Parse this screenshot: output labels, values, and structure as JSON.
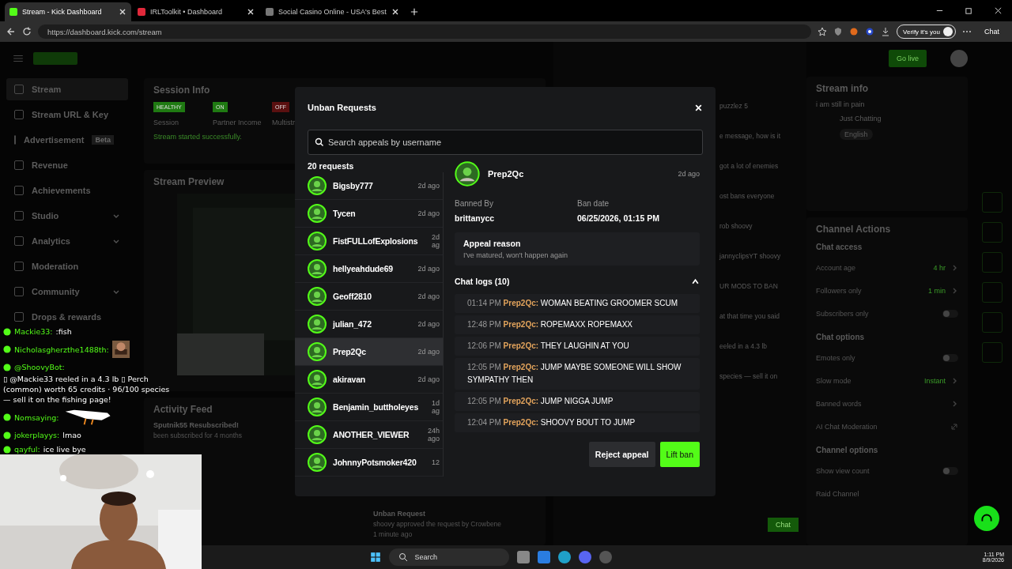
{
  "browser": {
    "tabs": [
      {
        "title": "Stream - Kick Dashboard",
        "selected": true
      },
      {
        "title": "IRLToolkit • Dashboard",
        "selected": false
      },
      {
        "title": "Social Casino Online - USA's Best",
        "selected": false
      }
    ],
    "url": "https://dashboard.kick.com/stream",
    "verify": "Verify it's you",
    "chat": "Chat"
  },
  "dashboard": {
    "sidebar": [
      {
        "label": "Stream",
        "selected": true,
        "expandable": false
      },
      {
        "label": "Stream URL & Key",
        "selected": false,
        "expandable": false
      },
      {
        "label": "Advertisement",
        "badge": "Beta",
        "selected": false,
        "expandable": false
      },
      {
        "label": "Revenue",
        "selected": false,
        "expandable": false
      },
      {
        "label": "Achievements",
        "selected": false,
        "expandable": false
      },
      {
        "label": "Studio",
        "selected": false,
        "expandable": true
      },
      {
        "label": "Analytics",
        "selected": false,
        "expandable": true
      },
      {
        "label": "Moderation",
        "selected": false,
        "expandable": false
      },
      {
        "label": "Community",
        "selected": false,
        "expandable": true
      },
      {
        "label": "Drops & rewards",
        "selected": false,
        "expandable": false
      }
    ],
    "session_info": {
      "title": "Session Info",
      "statuses": [
        {
          "badge": "HEALTHY",
          "label": "Session",
          "color": "#1f7a12"
        },
        {
          "badge": "ON",
          "label": "Partner Income",
          "color": "#1f7a12"
        },
        {
          "badge": "OFF",
          "label": "Multistr",
          "color": "#5a1010"
        }
      ],
      "message": "Stream started successfully."
    },
    "stream_preview": {
      "title": "Stream Preview"
    },
    "activity_feed": {
      "title": "Activity Feed",
      "items": [
        {
          "title": "Sputnik55 Resubscribed!",
          "detail": "been subscribed for 4 months"
        },
        {
          "title": "Unban Request",
          "detail": "shoovy approved the request by Crowbene",
          "time": "1 minute ago"
        }
      ]
    },
    "mid_chat": {
      "lines": [
        "puzzlez 5",
        "e message, how is it",
        "got a lot of enemies",
        "ost bans everyone",
        "rob shoovy",
        "jannyclipsYT shoovy",
        "UR MODS TO BAN",
        "at that time you said",
        "eeled in a 4.3 lb",
        "species — sell it on"
      ],
      "send": "Chat"
    },
    "go_live": "Go live",
    "stream_info": {
      "title": "Stream info",
      "stream_title": "i am still in pain",
      "category": "Just Chatting",
      "language": "English"
    },
    "channel_actions": {
      "title": "Channel Actions",
      "sections": [
        {
          "heading": "Chat access",
          "rows": [
            {
              "label": "Account age",
              "kind": "value",
              "value": "4 hr"
            },
            {
              "label": "Followers only",
              "kind": "value",
              "value": "1 min"
            },
            {
              "label": "Subscribers only",
              "kind": "toggle",
              "on": false
            }
          ]
        },
        {
          "heading": "Chat options",
          "rows": [
            {
              "label": "Emotes only",
              "kind": "toggle",
              "on": false
            },
            {
              "label": "Slow mode",
              "kind": "value",
              "value": "Instant"
            },
            {
              "label": "Banned words",
              "kind": "link"
            },
            {
              "label": "AI Chat Moderation",
              "kind": "external"
            }
          ]
        },
        {
          "heading": "Channel options",
          "rows": [
            {
              "label": "Show view count",
              "kind": "toggle",
              "on": false
            },
            {
              "label": "Raid Channel",
              "kind": "plain"
            }
          ]
        }
      ]
    }
  },
  "modal": {
    "title": "Unban Requests",
    "search_placeholder": "Search appeals by username",
    "count": "20 requests",
    "requests": [
      {
        "name": "Bigsby777",
        "time": "2d ago",
        "selected": false
      },
      {
        "name": "Tycen",
        "time": "2d ago",
        "selected": false
      },
      {
        "name": "FistFULLofExplosions",
        "time": "2d ag",
        "selected": false
      },
      {
        "name": "hellyeahdude69",
        "time": "2d ago",
        "selected": false
      },
      {
        "name": "Geoff2810",
        "time": "2d ago",
        "selected": false
      },
      {
        "name": "julian_472",
        "time": "2d ago",
        "selected": false
      },
      {
        "name": "Prep2Qc",
        "time": "2d ago",
        "selected": true
      },
      {
        "name": "akiravan",
        "time": "2d ago",
        "selected": false
      },
      {
        "name": "Benjamin_buttholeyes",
        "time": "1d ag",
        "selected": false
      },
      {
        "name": "ANOTHER_VIEWER",
        "time": "24h ago",
        "selected": false
      },
      {
        "name": "JohnnyPotsmoker420",
        "time": "12",
        "selected": false
      }
    ],
    "detail": {
      "name": "Prep2Qc",
      "time": "2d ago",
      "banned_by_label": "Banned By",
      "banned_by": "brittanycc",
      "ban_date_label": "Ban date",
      "ban_date": "06/25/2026, 01:15 PM",
      "reason_label": "Appeal reason",
      "reason": "I've matured, won't happen again"
    },
    "chat_logs": {
      "title": "Chat logs (10)",
      "expanded": true,
      "entries": [
        {
          "time": "01:14 PM",
          "user": "Prep2Qc:",
          "message": "WOMAN BEATING GROOMER SCUM"
        },
        {
          "time": "12:48 PM",
          "user": "Prep2Qc:",
          "message": "ROPEMAXX ROPEMAXX"
        },
        {
          "time": "12:06 PM",
          "user": "Prep2Qc:",
          "message": "THEY LAUGHIN AT YOU"
        },
        {
          "time": "12:05 PM",
          "user": "Prep2Qc:",
          "message": "JUMP MAYBE SOMEONE WILL SHOW SYMPATHY THEN"
        },
        {
          "time": "12:05 PM",
          "user": "Prep2Qc:",
          "message": "JUMP NIGGA JUMP"
        },
        {
          "time": "12:04 PM",
          "user": "Prep2Qc:",
          "message": "SHOOVY BOUT TO JUMP"
        }
      ]
    },
    "reject": "Reject appeal",
    "lift": "Lift ban"
  },
  "overlay_chat": [
    {
      "user": "Mackie33:",
      "message": ":fish",
      "kind": "text"
    },
    {
      "user": "Nicholasgherzthe1488th:",
      "kind": "emote"
    },
    {
      "user": "@ShoovyBot:",
      "message": "▯ @Mackie33 reeled in a 4.3 lb ▯ Perch (common) worth 65 credits · 96/100 species — sell it on the fishing page!",
      "kind": "text"
    },
    {
      "user": "Nomsaying:",
      "kind": "goose"
    },
    {
      "user": "jokerplayys:",
      "message": "lmao",
      "kind": "text"
    },
    {
      "user": "qayful:",
      "message": "ice live bye",
      "kind": "text"
    }
  ],
  "taskbar": {
    "search": "Search",
    "time": "1:11 PM",
    "date": "8/9/2026"
  }
}
